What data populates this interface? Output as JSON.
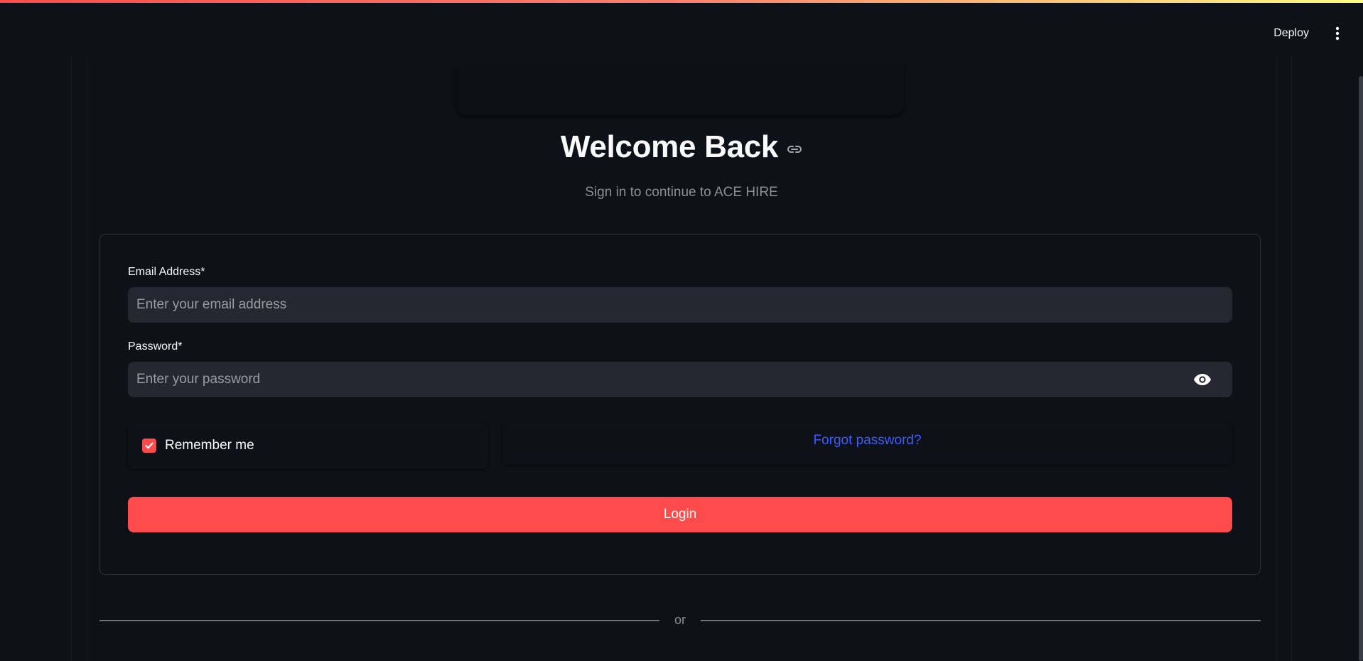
{
  "header": {
    "deploy_label": "Deploy",
    "menu_icon": "kebab-menu-icon"
  },
  "page": {
    "title": "Welcome Back",
    "subtitle": "Sign in to continue to ACE HIRE"
  },
  "form": {
    "email": {
      "label": "Email Address*",
      "placeholder": "Enter your email address",
      "value": ""
    },
    "password": {
      "label": "Password*",
      "placeholder": "Enter your password",
      "value": "",
      "toggle_icon": "eye-icon"
    },
    "remember_me": {
      "label": "Remember me",
      "checked": true
    },
    "forgot_password_label": "Forgot password?",
    "login_label": "Login"
  },
  "divider": {
    "text": "or"
  },
  "colors": {
    "background": "#0e1117",
    "accent": "#ff4b4b",
    "link": "#3d5cff",
    "input_bg": "#262730",
    "muted_text": "#8b8f98"
  }
}
